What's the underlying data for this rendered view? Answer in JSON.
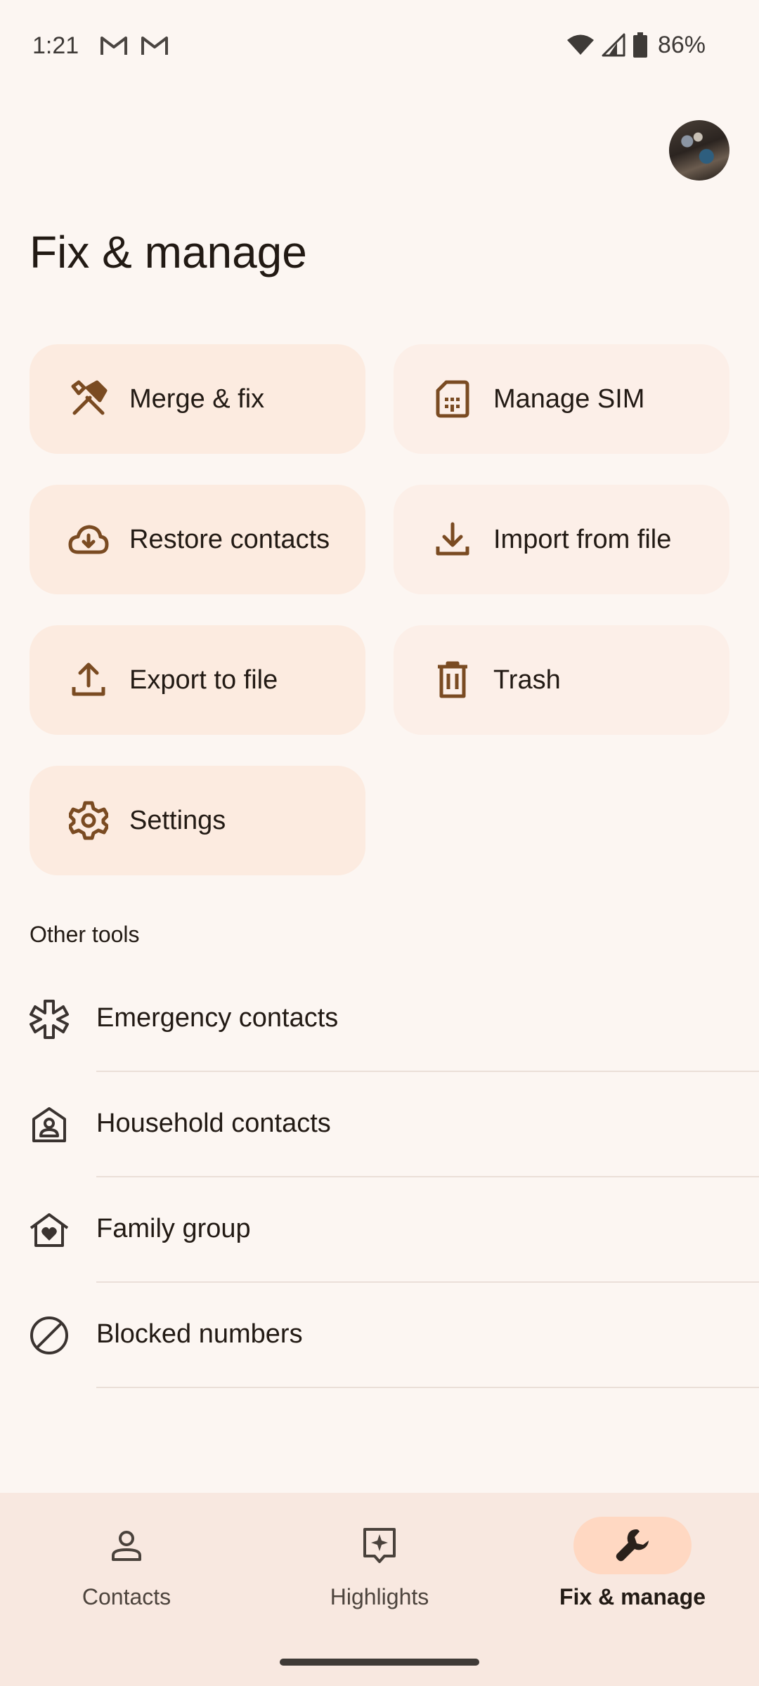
{
  "status_bar": {
    "time": "1:21",
    "battery": "86%",
    "icons": [
      "gmail-icon",
      "gmail-icon",
      "wifi-icon",
      "signal-icon",
      "battery-icon"
    ]
  },
  "header": {
    "title": "Fix & manage",
    "avatar": "account-avatar"
  },
  "tiles": [
    {
      "label": "Merge & fix",
      "icon": "merge-fix-icon"
    },
    {
      "label": "Manage SIM",
      "icon": "sim-card-icon"
    },
    {
      "label": "Restore contacts",
      "icon": "cloud-download-icon"
    },
    {
      "label": "Import from file",
      "icon": "download-icon"
    },
    {
      "label": "Export to file",
      "icon": "upload-icon"
    },
    {
      "label": "Trash",
      "icon": "trash-icon"
    },
    {
      "label": "Settings",
      "icon": "gear-icon"
    }
  ],
  "other_tools": {
    "heading": "Other tools",
    "items": [
      {
        "label": "Emergency contacts",
        "icon": "emergency-asterisk-icon"
      },
      {
        "label": "Household contacts",
        "icon": "household-icon"
      },
      {
        "label": "Family group",
        "icon": "family-home-icon"
      },
      {
        "label": "Blocked numbers",
        "icon": "block-icon"
      }
    ]
  },
  "bottom_nav": {
    "items": [
      {
        "label": "Contacts",
        "icon": "person-icon",
        "active": false
      },
      {
        "label": "Highlights",
        "icon": "highlights-icon",
        "active": false
      },
      {
        "label": "Fix & manage",
        "icon": "wrench-icon",
        "active": true
      }
    ]
  },
  "colors": {
    "background": "#fcf6f2",
    "tile": "#fcebe0",
    "icon_brown": "#7a4b22",
    "nav_background": "#f8e8e0",
    "nav_active_pill": "#ffd8c2"
  }
}
